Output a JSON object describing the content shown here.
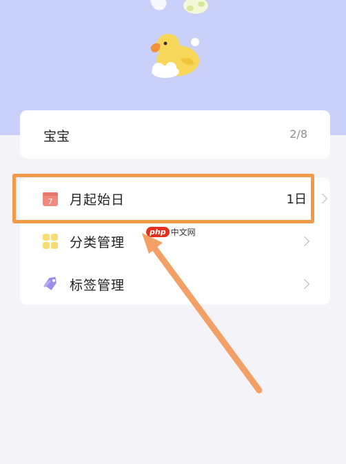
{
  "baby_card": {
    "name": "宝宝",
    "count": "2/8"
  },
  "settings": {
    "rows": [
      {
        "label": "月起始日",
        "value": "1日",
        "icon": "calendar-icon",
        "icon_text": "7",
        "icon_color": "#f08a7e"
      },
      {
        "label": "分类管理",
        "value": "",
        "icon": "grid-icon",
        "icon_color": "#f7dc6f"
      },
      {
        "label": "标签管理",
        "value": "",
        "icon": "tag-icon",
        "icon_color": "#9a8ee8"
      }
    ]
  },
  "watermark": {
    "badge": "php",
    "site": "中文网"
  },
  "colors": {
    "hero": "#c9d1fb",
    "highlight": "#f39a4a",
    "page": "#f3f3f8"
  }
}
